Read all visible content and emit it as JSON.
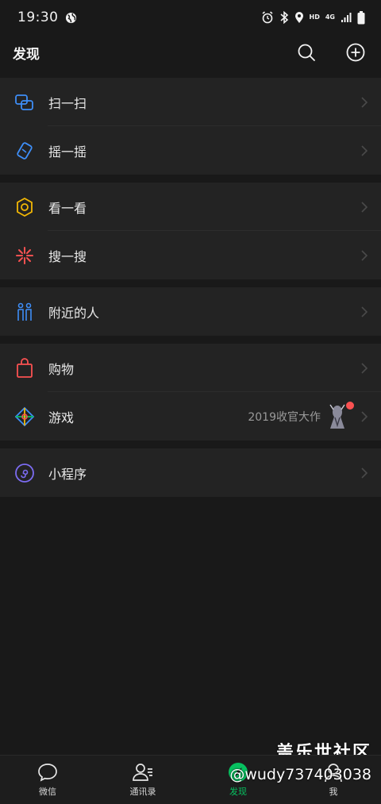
{
  "status_bar": {
    "time": "19:30",
    "hd": "HD",
    "network": "4G"
  },
  "header": {
    "title": "发现"
  },
  "menu": {
    "groups": [
      {
        "items": [
          {
            "label": "扫一扫",
            "icon": "scan-icon"
          },
          {
            "label": "摇一摇",
            "icon": "shake-icon"
          }
        ]
      },
      {
        "items": [
          {
            "label": "看一看",
            "icon": "top-stories-icon"
          },
          {
            "label": "搜一搜",
            "icon": "search-feature-icon"
          }
        ]
      },
      {
        "items": [
          {
            "label": "附近的人",
            "icon": "people-nearby-icon"
          }
        ]
      },
      {
        "items": [
          {
            "label": "购物",
            "icon": "shopping-bag-icon"
          },
          {
            "label": "游戏",
            "icon": "games-icon",
            "subtitle": "2019收官大作",
            "badge": "red-dot"
          }
        ]
      },
      {
        "items": [
          {
            "label": "小程序",
            "icon": "mini-programs-icon"
          }
        ]
      }
    ]
  },
  "tabbar": {
    "tabs": [
      {
        "label": "微信",
        "icon": "chat-bubble-icon",
        "active": false
      },
      {
        "label": "通讯录",
        "icon": "contacts-icon",
        "active": false
      },
      {
        "label": "发现",
        "icon": "compass-icon",
        "active": true
      },
      {
        "label": "我",
        "icon": "profile-icon",
        "active": false
      }
    ]
  },
  "watermark": {
    "title": "盖乐世社区",
    "handle": "@wudy737403038"
  },
  "colors": {
    "background": "#191919",
    "cell": "#232323",
    "accent_green": "#07c160",
    "badge_red": "#fa5151"
  }
}
